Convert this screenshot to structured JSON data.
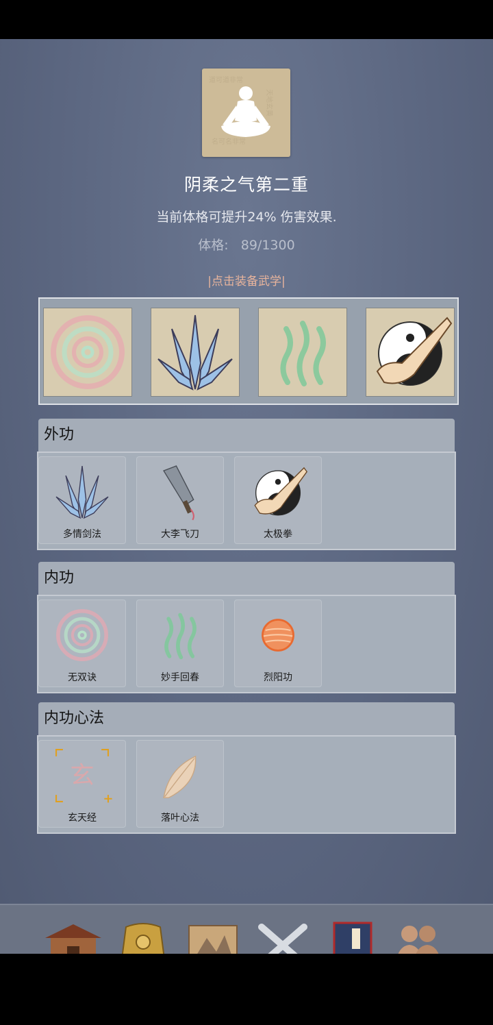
{
  "header": {
    "realm_title": "阴柔之气第二重",
    "realm_desc": "当前体格可提升24% 伤害效果.",
    "stat_label": "体格:",
    "stat_value": "89/1300",
    "equip_hint": "|点击装备武学|"
  },
  "equipped": [
    {
      "icon": "spiral-icon"
    },
    {
      "icon": "sword-fan-icon"
    },
    {
      "icon": "wave-icon"
    },
    {
      "icon": "taiji-fist-icon"
    }
  ],
  "sections": [
    {
      "title": "外功",
      "items": [
        {
          "label": "多情剑法",
          "icon": "sword-fan-icon"
        },
        {
          "label": "大李飞刀",
          "icon": "flying-knife-icon"
        },
        {
          "label": "太极拳",
          "icon": "taiji-fist-icon"
        }
      ]
    },
    {
      "title": "内功",
      "items": [
        {
          "label": "无双诀",
          "icon": "spiral-icon"
        },
        {
          "label": "妙手回春",
          "icon": "wave-icon"
        },
        {
          "label": "烈阳功",
          "icon": "sun-orb-icon"
        }
      ]
    },
    {
      "title": "内功心法",
      "items": [
        {
          "label": "玄天经",
          "icon": "xuan-glyph-icon",
          "glyph": "玄"
        },
        {
          "label": "落叶心法",
          "icon": "leaf-icon"
        }
      ]
    }
  ],
  "nav": [
    {
      "label": "首页",
      "icon": "house-icon"
    },
    {
      "label": "装备",
      "icon": "armor-icon"
    },
    {
      "label": "江湖",
      "icon": "scroll-map-icon"
    },
    {
      "label": "闯关",
      "icon": "crossed-swords-icon"
    },
    {
      "label": "武功",
      "icon": "book-icon"
    },
    {
      "label": "伙伴",
      "icon": "partners-icon"
    }
  ],
  "colors": {
    "background": "#5b6680",
    "accent_gold": "#f1c233",
    "hint": "#e8b49c",
    "parchment": "#d8ccb0"
  }
}
